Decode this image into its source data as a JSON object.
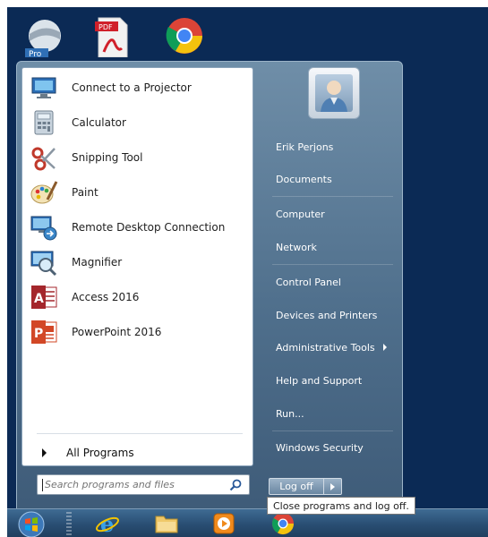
{
  "desktop": {
    "icons": [
      {
        "name": "Google Earth Pro",
        "label": "Pro"
      },
      {
        "name": "PDF document",
        "label": "PDF"
      },
      {
        "name": "Google Chrome",
        "label": ""
      }
    ]
  },
  "start_menu": {
    "programs": [
      {
        "label": "Connect to a Projector",
        "icon": "projector-icon"
      },
      {
        "label": "Calculator",
        "icon": "calculator-icon"
      },
      {
        "label": "Snipping Tool",
        "icon": "scissors-icon"
      },
      {
        "label": "Paint",
        "icon": "paint-palette-icon"
      },
      {
        "label": "Remote Desktop Connection",
        "icon": "remote-desktop-icon"
      },
      {
        "label": "Magnifier",
        "icon": "magnifier-icon"
      },
      {
        "label": "Access 2016",
        "icon": "access-icon"
      },
      {
        "label": "PowerPoint 2016",
        "icon": "powerpoint-icon"
      }
    ],
    "all_programs": "All Programs",
    "search": {
      "placeholder": "Search programs and files",
      "value": ""
    },
    "user": {
      "name": "Erik Perjons"
    },
    "right_items": [
      {
        "label": "Erik Perjons",
        "has_submenu": false
      },
      {
        "label": "Documents",
        "has_submenu": false
      },
      {
        "label": "Computer",
        "has_submenu": false
      },
      {
        "label": "Network",
        "has_submenu": false
      },
      {
        "label": "Control Panel",
        "has_submenu": false
      },
      {
        "label": "Devices and Printers",
        "has_submenu": false
      },
      {
        "label": "Administrative Tools",
        "has_submenu": true
      },
      {
        "label": "Help and Support",
        "has_submenu": false
      },
      {
        "label": "Run...",
        "has_submenu": false
      },
      {
        "label": "Windows Security",
        "has_submenu": false
      }
    ],
    "log_off": "Log off",
    "tooltip": "Close programs and log off."
  },
  "taskbar": {
    "items": [
      "start-orb",
      "internet-explorer-icon",
      "file-explorer-icon",
      "media-player-icon",
      "chrome-icon"
    ]
  },
  "colors": {
    "desktop_bg": "#0b2a55",
    "menu_bg": "#4f6f8c",
    "accent_access": "#a4262c",
    "accent_powerpoint": "#d24726"
  }
}
